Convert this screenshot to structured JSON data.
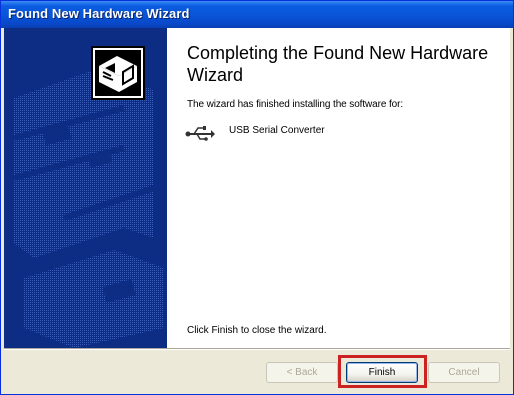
{
  "window": {
    "title": "Found New Hardware Wizard"
  },
  "content": {
    "heading": "Completing the Found New Hardware Wizard",
    "description": "The wizard has finished installing the software for:",
    "device_icon": "usb-icon",
    "device_name": "USB Serial Converter",
    "closing_text": "Click Finish to close the wizard."
  },
  "buttons": {
    "back": "< Back",
    "finish": "Finish",
    "cancel": "Cancel"
  },
  "colors": {
    "titlebar": "#0a55d8",
    "side_panel": "#0c2d83",
    "highlight": "#cc2222"
  }
}
